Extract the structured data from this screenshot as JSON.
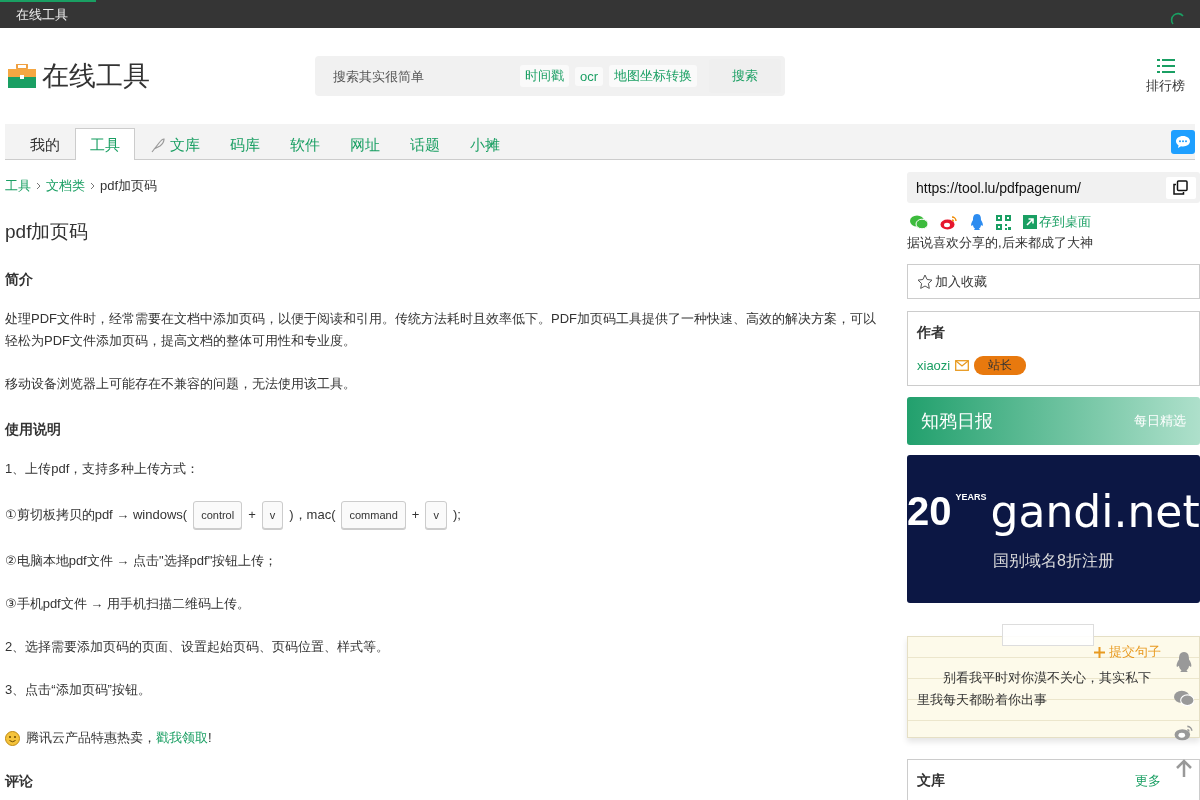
{
  "top_bar": {
    "tab": "在线工具"
  },
  "header": {
    "logo_text": "在线工具",
    "search": {
      "placeholder": "搜索其实很简单"
    },
    "quick_links": [
      "时间戳",
      "ocr",
      "地图坐标转换"
    ],
    "search_button": "搜索",
    "ranking": "排行榜"
  },
  "nav": {
    "items": [
      {
        "label": "我的",
        "selected": false
      },
      {
        "label": "工具",
        "selected": true
      },
      {
        "label": "文库",
        "selected": false
      },
      {
        "label": "码库",
        "selected": false
      },
      {
        "label": "软件",
        "selected": false
      },
      {
        "label": "网址",
        "selected": false
      },
      {
        "label": "话题",
        "selected": false
      },
      {
        "label": "小摊",
        "selected": false
      }
    ]
  },
  "breadcrumb": [
    {
      "label": "工具",
      "kind": "link"
    },
    {
      "label": "文档类",
      "kind": "link"
    },
    {
      "label": "pdf加页码",
      "kind": "current"
    }
  ],
  "title": "pdf加页码",
  "blocks": [
    {
      "kind": "heading",
      "text": "简介"
    },
    {
      "kind": "paragraph",
      "text": "处理PDF文件时，经常需要在文档中添加页码，以便于阅读和引用。传统方法耗时且效率低下。PDF加页码工具提供了一种快速、高效的解决方案，可以轻松为PDF文件添加页码，提高文档的整体可用性和专业度。"
    },
    {
      "kind": "paragraph",
      "text": "移动设备浏览器上可能存在不兼容的问题，无法使用该工具。"
    },
    {
      "kind": "heading",
      "text": "使用说明"
    },
    {
      "kind": "paragraph",
      "text": "1、上传pdf，支持多种上传方式："
    },
    {
      "kind": "keys",
      "parts": [
        {
          "kind": "text",
          "text": "①剪切板拷贝的pdf → windows("
        },
        {
          "kind": "key",
          "text": "control"
        },
        {
          "kind": "text",
          "text": "+"
        },
        {
          "kind": "key",
          "text": "v"
        },
        {
          "kind": "text",
          "text": ")，mac("
        },
        {
          "kind": "key",
          "text": "command"
        },
        {
          "kind": "text",
          "text": "+"
        },
        {
          "kind": "key",
          "text": "v"
        },
        {
          "kind": "text",
          "text": ");"
        }
      ]
    },
    {
      "kind": "paragraph",
      "text": "②电脑本地pdf文件 → 点击\"选择pdf\"按钮上传；"
    },
    {
      "kind": "paragraph",
      "text": "③手机pdf文件 → 用手机扫描二维码上传。"
    },
    {
      "kind": "paragraph",
      "text": "2、选择需要添加页码的页面、设置起始页码、页码位置、样式等。"
    },
    {
      "kind": "paragraph",
      "text": "3、点击“添加页码”按钮。"
    },
    {
      "kind": "promo",
      "text": "腾讯云产品特惠热卖，",
      "link": "戳我领取",
      "tail": "!"
    },
    {
      "kind": "heading",
      "text": "评论"
    }
  ],
  "sidebar": {
    "url": "https://tool.lu/pdfpagenum/",
    "save_desktop": "存到桌面",
    "share_note": "据说喜欢分享的,后来都成了大神",
    "favorite": "加入收藏",
    "author": {
      "heading": "作者",
      "name": "xiaozi",
      "badge": "站长"
    },
    "daily": {
      "title": "知鸦日报",
      "subtitle": "每日精选"
    },
    "ad": {
      "number": "20",
      "years": "YEARS",
      "brand": "gandi.net",
      "offer": "国别域名8折注册"
    },
    "quote": {
      "submit": "提交句子",
      "text": "别看我平时对你漠不关心，其实私下里我每天都盼着你出事"
    },
    "library": {
      "title": "文库",
      "more": "更多"
    }
  }
}
